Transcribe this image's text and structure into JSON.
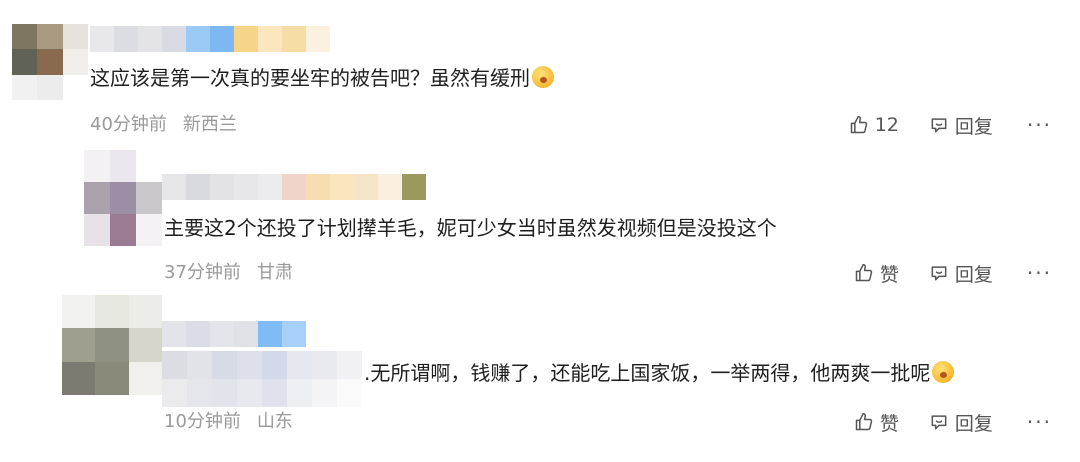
{
  "comments": [
    {
      "text": "这应该是第一次真的要坐牢的被告吧？虽然有缓刑",
      "time": "40分钟前",
      "location": "新西兰",
      "like_label": "12",
      "reply_label": "回复",
      "more_label": "···"
    },
    {
      "text": "主要这2个还投了计划撵羊毛，妮可少女当时虽然发视频但是没投这个",
      "time": "37分钟前",
      "location": "甘肃",
      "like_label": "赞",
      "reply_label": "回复",
      "more_label": "···"
    },
    {
      "text": "无所谓啊，钱赚了，还能吃上国家饭，一举两得，他两爽一批呢",
      "time": "10分钟前",
      "location": "山东",
      "like_label": "赞",
      "reply_label": "回复",
      "more_label": "···"
    }
  ],
  "icons": {
    "like": "thumbs-up-icon",
    "reply": "speech-bubble-icon",
    "more": "more-dots-icon",
    "emoji": "yawning-face-emoji-icon"
  },
  "colors": {
    "meta_text": "#9a9a9a",
    "body_text": "#1f1f1f",
    "action_text": "#555555"
  }
}
